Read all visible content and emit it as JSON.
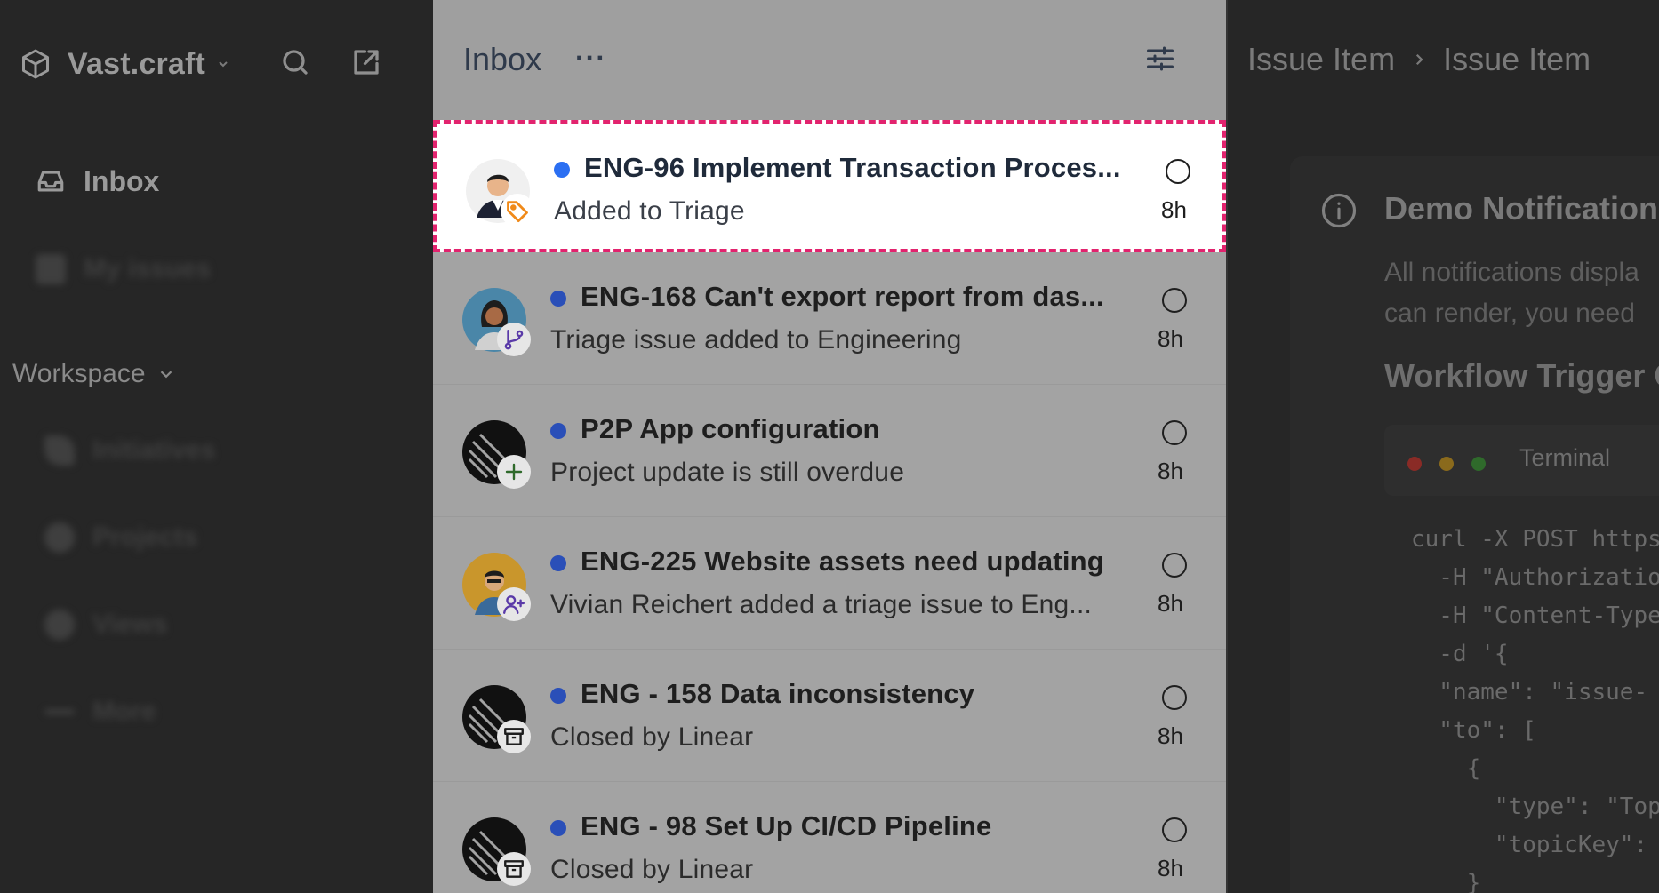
{
  "sidebar": {
    "workspace_name": "Vast.craft",
    "nav": {
      "inbox_label": "Inbox",
      "my_issues_label": "My issues"
    },
    "workspace_section_label": "Workspace",
    "workspace_items": [
      "Initiatives",
      "Projects",
      "Views",
      "More"
    ]
  },
  "inbox": {
    "title": "Inbox",
    "more_label": "···",
    "items": [
      {
        "title": "ENG-96 Implement Transaction Proces...",
        "subtitle": "Added to Triage",
        "time": "8h",
        "badge_icon": "tag-icon"
      },
      {
        "title": "ENG-168 Can't export report from das...",
        "subtitle": "Triage issue added to Engineering",
        "time": "8h",
        "badge_icon": "branch-icon"
      },
      {
        "title": "P2P App configuration",
        "subtitle": "Project update is still overdue",
        "time": "8h",
        "badge_icon": "plus-icon"
      },
      {
        "title": "ENG-225 Website assets need updating",
        "subtitle": "Vivian Reichert added a triage issue to Eng...",
        "time": "8h",
        "badge_icon": "add-user-icon"
      },
      {
        "title": "ENG - 158 Data inconsistency",
        "subtitle": "Closed by Linear",
        "time": "8h",
        "badge_icon": "archive-icon"
      },
      {
        "title": "ENG - 98 Set Up CI/CD Pipeline",
        "subtitle": "Closed by Linear",
        "time": "8h",
        "badge_icon": "archive-icon"
      }
    ]
  },
  "detail": {
    "breadcrumb": [
      "Issue Item",
      "Issue Item"
    ],
    "card_title": "Demo Notifications",
    "card_desc_line1": "All notifications displa",
    "card_desc_line2": "can render, you need",
    "workflow_title": "Workflow Trigger C",
    "terminal_label": "Terminal",
    "code_lines": [
      "curl -X POST https",
      "  -H \"Authorizatio",
      "  -H \"Content-Type",
      "  -d '{",
      "  \"name\": \"issue-",
      "  \"to\": [",
      "    {",
      "      \"type\": \"Top",
      "      \"topicKey\":",
      "    }"
    ]
  },
  "colors": {
    "selection_border": "#e2236e",
    "unread_dot": "#2b6ff2",
    "traffic_red": "#8a2b26",
    "traffic_yellow": "#8a6a1c",
    "traffic_green": "#2f6a2b"
  }
}
